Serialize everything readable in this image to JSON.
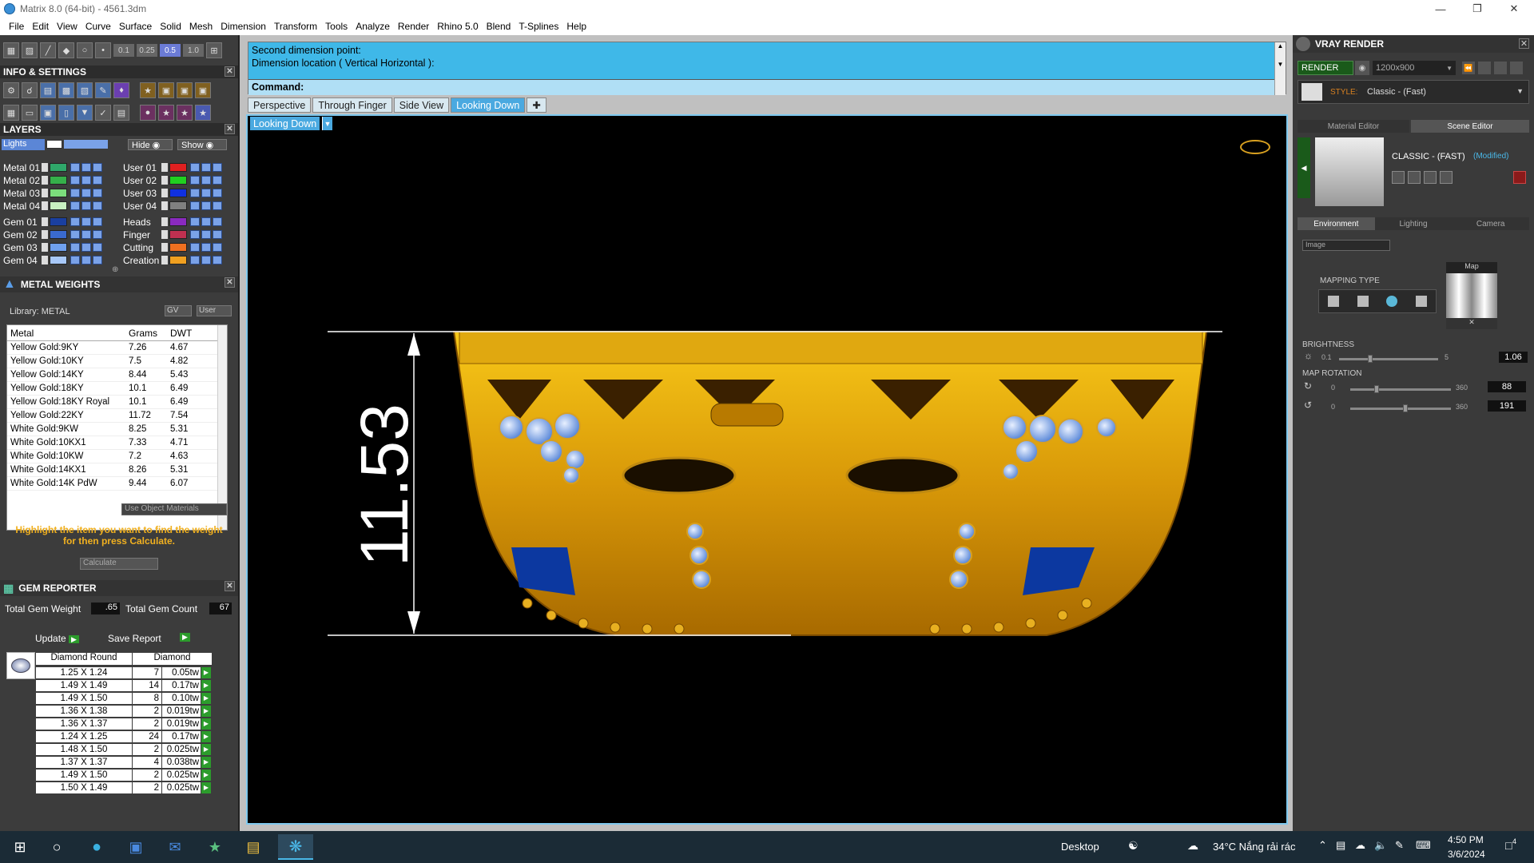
{
  "window": {
    "title": "Matrix 8.0 (64-bit) - 4561.3dm",
    "min_icon": "minimize-icon",
    "max_icon": "maximize-icon",
    "close_icon": "close-icon"
  },
  "menu": [
    "File",
    "Edit",
    "View",
    "Curve",
    "Surface",
    "Solid",
    "Mesh",
    "Dimension",
    "Transform",
    "Tools",
    "Analyze",
    "Render",
    "Rhino 5.0",
    "Blend",
    "T-Splines",
    "Help"
  ],
  "toolbar_nums": [
    "0.1",
    "0.25",
    "0.5",
    "1.0"
  ],
  "info_settings": {
    "title": "INFO & SETTINGS"
  },
  "layers": {
    "title": "LAYERS",
    "lights": "Lights",
    "hide": "Hide",
    "show": "Show",
    "left": [
      {
        "name": "Metal 01",
        "color": "#2fa86a"
      },
      {
        "name": "Metal 02",
        "color": "#35b04a"
      },
      {
        "name": "Metal 03",
        "color": "#7cde7c"
      },
      {
        "name": "Metal 04",
        "color": "#c8f0c0"
      },
      {
        "name": "Gem 01",
        "color": "#1a3fa0"
      },
      {
        "name": "Gem 02",
        "color": "#3a6ad0"
      },
      {
        "name": "Gem 03",
        "color": "#6fa0ee"
      },
      {
        "name": "Gem 04",
        "color": "#a8c8f8"
      }
    ],
    "right": [
      {
        "name": "User 01",
        "color": "#e02020"
      },
      {
        "name": "User 02",
        "color": "#20d020"
      },
      {
        "name": "User 03",
        "color": "#1030e0"
      },
      {
        "name": "User 04",
        "color": "#808080"
      },
      {
        "name": "Heads",
        "color": "#8a2ac0"
      },
      {
        "name": "Finger",
        "color": "#c03050"
      },
      {
        "name": "Cutting",
        "color": "#f07020"
      },
      {
        "name": "Creation",
        "color": "#f0a020"
      }
    ]
  },
  "metal_weights": {
    "title": "METAL WEIGHTS",
    "library": "Library: METAL",
    "gv": "GV",
    "user": "User",
    "headers": [
      "Metal",
      "Grams",
      "DWT"
    ],
    "rows": [
      [
        "Yellow Gold:9KY",
        "7.26",
        "4.67"
      ],
      [
        "Yellow Gold:10KY",
        "7.5",
        "4.82"
      ],
      [
        "Yellow Gold:14KY",
        "8.44",
        "5.43"
      ],
      [
        "Yellow Gold:18KY",
        "10.1",
        "6.49"
      ],
      [
        "Yellow Gold:18KY Royal",
        "10.1",
        "6.49"
      ],
      [
        "Yellow Gold:22KY",
        "11.72",
        "7.54"
      ],
      [
        "White Gold:9KW",
        "8.25",
        "5.31"
      ],
      [
        "White Gold:10KX1",
        "7.33",
        "4.71"
      ],
      [
        "White Gold:10KW",
        "7.2",
        "4.63"
      ],
      [
        "White Gold:14KX1",
        "8.26",
        "5.31"
      ],
      [
        "White Gold:14K PdW",
        "9.44",
        "6.07"
      ]
    ],
    "use_object_materials": "Use Object Materials",
    "hint": "Highlight the item you want to find the weight for then press Calculate.",
    "calculate": "Calculate"
  },
  "gem_reporter": {
    "title": "GEM REPORTER",
    "total_weight_label": "Total Gem Weight",
    "total_weight": ".65",
    "total_count_label": "Total Gem Count",
    "total_count": "67",
    "update": "Update",
    "save_report": "Save Report",
    "headers": [
      "Diamond Round",
      "Diamond"
    ],
    "rows": [
      [
        "1.25 X 1.24",
        "7",
        "0.05tw"
      ],
      [
        "1.49 X 1.49",
        "14",
        "0.17tw"
      ],
      [
        "1.49 X 1.50",
        "8",
        "0.10tw"
      ],
      [
        "1.36 X 1.38",
        "2",
        "0.019tw"
      ],
      [
        "1.36 X 1.37",
        "2",
        "0.019tw"
      ],
      [
        "1.24 X 1.25",
        "24",
        "0.17tw"
      ],
      [
        "1.48 X 1.50",
        "2",
        "0.025tw"
      ],
      [
        "1.37 X 1.37",
        "4",
        "0.038tw"
      ],
      [
        "1.49 X 1.50",
        "2",
        "0.025tw"
      ],
      [
        "1.50 X 1.49",
        "2",
        "0.025tw"
      ]
    ]
  },
  "command": {
    "line1": "Second dimension point:",
    "line2": "Dimension location ( Vertical  Horizontal ):",
    "prompt": "Command:"
  },
  "view_tabs": [
    "Perspective",
    "Through Finger",
    "Side View",
    "Looking Down"
  ],
  "active_view": "Looking Down",
  "dimension_label": "11.53",
  "vray": {
    "title": "VRAY RENDER",
    "render": "RENDER",
    "resolution": "1200x900",
    "style_label": "STYLE:",
    "style": "Classic - (Fast)",
    "tab_material": "Material Editor",
    "tab_scene": "Scene Editor",
    "preset": "CLASSIC - (FAST)",
    "modified": "(Modified)",
    "subtabs": [
      "Environment",
      "Lighting",
      "Camera"
    ],
    "env_type": "Image",
    "mapping_type": "MAPPING TYPE",
    "map": "Map",
    "brightness": "BRIGHTNESS",
    "brightness_min": "0.1",
    "brightness_max": "5",
    "brightness_val": "1.06",
    "map_rotation": "MAP ROTATION",
    "rot1_min": "0",
    "rot1_max": "360",
    "rot1_val": "88",
    "rot2_min": "0",
    "rot2_max": "360",
    "rot2_val": "191"
  },
  "taskbar": {
    "desktop": "Desktop",
    "weather": "34°C  Nắng rải rác",
    "time": "4:50 PM",
    "date": "3/6/2024",
    "notif": "4"
  }
}
